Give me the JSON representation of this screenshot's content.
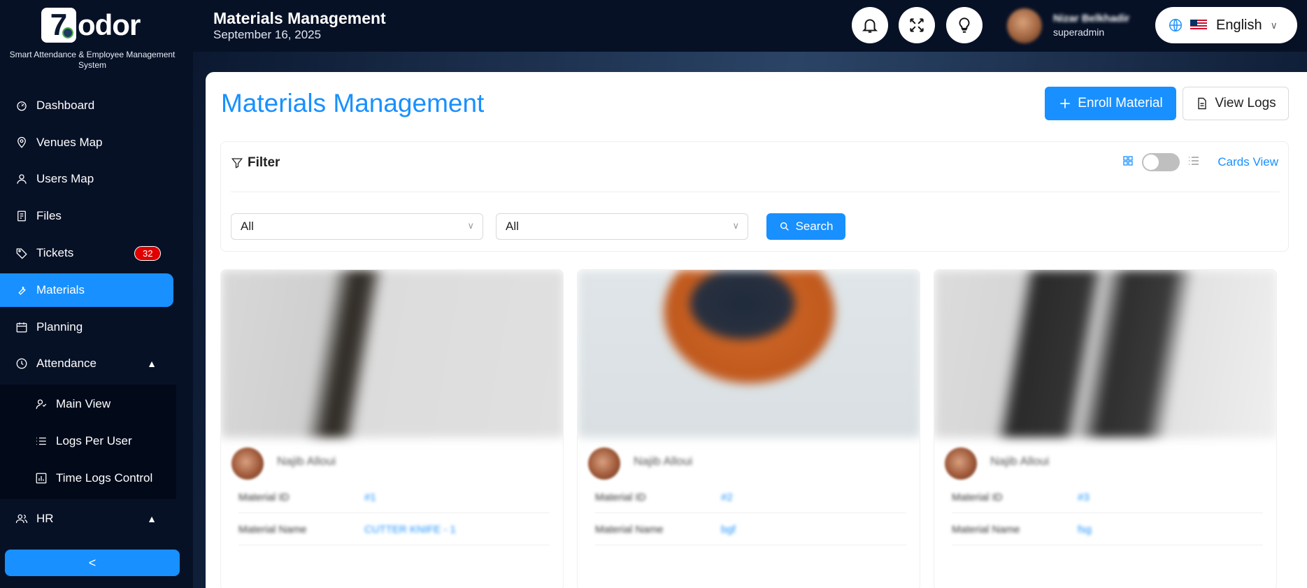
{
  "brand": {
    "logo_digit": "7",
    "logo_text": "odor",
    "tagline": "Smart Attendance & Employee Management System"
  },
  "sidebar": {
    "items": [
      {
        "label": "Dashboard",
        "icon": "dashboard-icon"
      },
      {
        "label": "Venues Map",
        "icon": "map-pin-icon"
      },
      {
        "label": "Users Map",
        "icon": "user-icon"
      },
      {
        "label": "Files",
        "icon": "file-icon"
      },
      {
        "label": "Tickets",
        "icon": "tag-icon",
        "badge": "32"
      },
      {
        "label": "Materials",
        "icon": "tool-icon",
        "active": true
      },
      {
        "label": "Planning",
        "icon": "calendar-icon"
      },
      {
        "label": "Attendance",
        "icon": "clock-icon",
        "expanded": true
      },
      {
        "label": "HR",
        "icon": "team-icon",
        "expanded": true
      }
    ],
    "attendance_sub": [
      {
        "label": "Main View",
        "icon": "users-icon"
      },
      {
        "label": "Logs Per User",
        "icon": "list-icon"
      },
      {
        "label": "Time Logs Control",
        "icon": "chart-box-icon"
      }
    ],
    "collapse_glyph": "<"
  },
  "header": {
    "title": "Materials Management",
    "date": "September 16, 2025",
    "user_name": "Nizar Belkhadir",
    "user_role": "superadmin",
    "language": "English"
  },
  "page": {
    "title": "Materials Management",
    "enroll_label": "Enroll Material",
    "logs_label": "View Logs",
    "filter_label": "Filter",
    "view_mode_label": "Cards View",
    "select1_value": "All",
    "select2_value": "All",
    "search_label": "Search"
  },
  "cards": [
    {
      "owner": "Najib Alloui",
      "rows": [
        {
          "k": "Material ID",
          "v": "#1"
        },
        {
          "k": "Material Name",
          "v": "CUTTER KNIFE - 1"
        }
      ]
    },
    {
      "owner": "Najib Alloui",
      "rows": [
        {
          "k": "Material ID",
          "v": "#2"
        },
        {
          "k": "Material Name",
          "v": "bgf"
        }
      ]
    },
    {
      "owner": "Najib Alloui",
      "rows": [
        {
          "k": "Material ID",
          "v": "#3"
        },
        {
          "k": "Material Name",
          "v": "fsg"
        }
      ]
    }
  ],
  "colors": {
    "accent": "#1890ff",
    "sidebar_bg": "#071126",
    "badge": "#e00000"
  }
}
